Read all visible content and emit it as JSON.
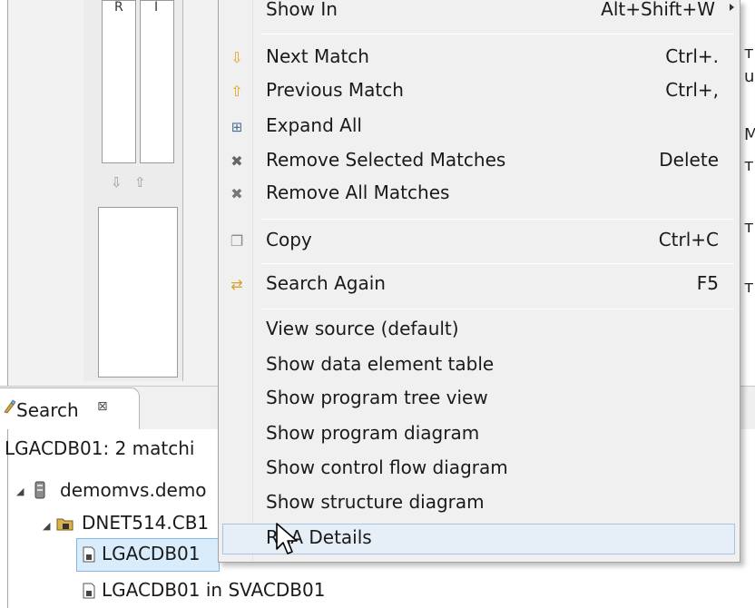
{
  "background": {
    "columns": [
      {
        "header": "R"
      },
      {
        "header": "I"
      }
    ],
    "move_down_icon": "arrow-down-icon",
    "move_up_icon": "arrow-up-icon",
    "right_fragments": [
      "т",
      "u",
      "M",
      "т",
      "т",
      "т"
    ]
  },
  "search_view": {
    "tab_label": "Search",
    "tab_close": "⊠",
    "summary": "LGACDB01: 2 matchi",
    "tree": [
      {
        "label": "demomvs.demo",
        "icon": "server-icon"
      },
      {
        "label": "DNET514.CB1",
        "icon": "folder-lock-icon"
      },
      {
        "label": "LGACDB01",
        "icon": "file-lock-icon"
      },
      {
        "label": "LGACDB01 in SVACDB01",
        "icon": "file-lock-icon"
      }
    ]
  },
  "context_menu": {
    "items": [
      {
        "label": "Show In",
        "accel": "Alt+Shift+W",
        "submenu": true
      },
      {
        "label": "Next Match",
        "accel": "Ctrl+.",
        "icon": "arrow-down-icon"
      },
      {
        "label": "Previous Match",
        "accel": "Ctrl+,",
        "icon": "arrow-up-icon"
      },
      {
        "label": "Expand All",
        "accel": "",
        "icon": "expand-all-icon"
      },
      {
        "label": "Remove Selected Matches",
        "accel": "Delete",
        "icon": "remove-icon"
      },
      {
        "label": "Remove All Matches",
        "accel": "",
        "icon": "remove-all-icon"
      },
      {
        "label": "Copy",
        "accel": "Ctrl+C",
        "icon": "copy-icon"
      },
      {
        "label": "Search Again",
        "accel": "F5",
        "icon": "refresh-icon"
      },
      {
        "label": "View source (default)"
      },
      {
        "label": "Show data element table"
      },
      {
        "label": "Show program tree view"
      },
      {
        "label": "Show program diagram"
      },
      {
        "label": "Show control flow diagram"
      },
      {
        "label": "Show structure diagram"
      },
      {
        "label": "RAA Details"
      }
    ]
  },
  "colors": {
    "menu_bg": "#f0f0f0",
    "selection": "#d9ecfb",
    "arrow_orange": "#e8a317"
  }
}
